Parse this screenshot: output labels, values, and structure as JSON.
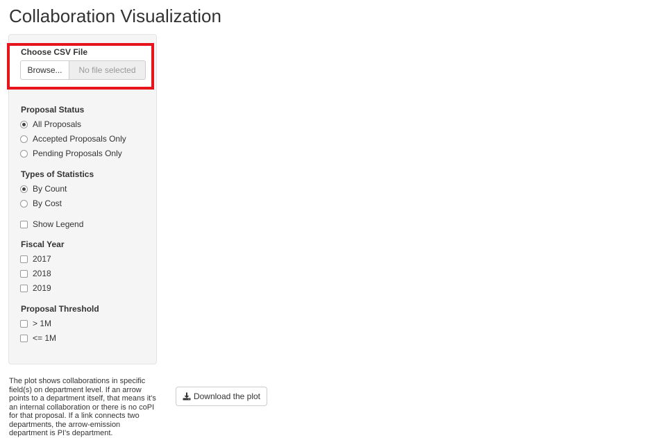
{
  "page": {
    "title": "Collaboration Visualization"
  },
  "file_input": {
    "label": "Choose CSV File",
    "browse_label": "Browse...",
    "placeholder": "No file selected"
  },
  "proposal_status": {
    "label": "Proposal Status",
    "options": [
      "All Proposals",
      "Accepted Proposals Only",
      "Pending Proposals Only"
    ],
    "selected": "All Proposals"
  },
  "statistics": {
    "label": "Types of Statistics",
    "options": [
      "By Count",
      "By Cost"
    ],
    "selected": "By Count"
  },
  "show_legend": {
    "label": "Show Legend",
    "checked": false
  },
  "fiscal_year": {
    "label": "Fiscal Year",
    "options": [
      "2017",
      "2018",
      "2019"
    ]
  },
  "threshold": {
    "label": "Proposal Threshold",
    "options": [
      "> 1M",
      "<= 1M"
    ]
  },
  "description": "The plot shows collaborations in specific field(s) on department level. If an arrow points to a department itself, that means it's an internal collaboration or there is no coPI for that proposal. If a link connects two departments, the arrow-emission department is PI's department.",
  "download": {
    "label": "Download the plot",
    "icon": "download-icon"
  },
  "colors": {
    "highlight": "#e8141c",
    "panel": "#f5f5f5"
  }
}
